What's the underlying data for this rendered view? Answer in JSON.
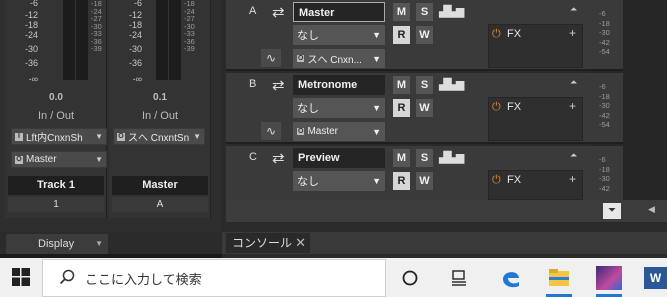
{
  "mixer": {
    "scale_labels": [
      "-6",
      "-12",
      "-18",
      "-24",
      "-30",
      "-36",
      "-∞"
    ],
    "mini_scale": [
      "-18",
      "-24",
      "-27",
      "-30",
      "-33",
      "-36",
      "-39"
    ],
    "strips": [
      {
        "level": "0.0",
        "io_label": "In / Out",
        "input_tag": "I",
        "input": "Lft内CnxnSh",
        "output_tag": "O",
        "output": "Master",
        "name": "Track 1",
        "number": "1"
      },
      {
        "level": "0.1",
        "io_label": "In / Out",
        "input_tag": "O",
        "input": "スへ CnxntSn",
        "name": "Master",
        "number": "A"
      }
    ],
    "display_label": "Display"
  },
  "tracks": [
    {
      "letter": "A",
      "name": "Master",
      "mute": "M",
      "solo": "S",
      "record": "R",
      "write": "W",
      "input": "なし",
      "output_tag": "O",
      "output": "スへ Cnxn...",
      "fx": "FX"
    },
    {
      "letter": "B",
      "name": "Metronome",
      "mute": "M",
      "solo": "S",
      "record": "R",
      "write": "W",
      "input": "なし",
      "output_tag": "O",
      "output": "Master",
      "fx": "FX"
    },
    {
      "letter": "C",
      "name": "Preview",
      "mute": "M",
      "solo": "S",
      "record": "R",
      "write": "W",
      "input": "なし",
      "fx": "FX"
    }
  ],
  "track_scale": [
    "-6",
    "-18",
    "-30",
    "-42",
    "-54"
  ],
  "console_tab": "コンソール",
  "taskbar": {
    "search_placeholder": "ここに入力して検索",
    "word_label": "W"
  },
  "icons": [
    "windows-icon",
    "search-icon",
    "cortana-icon",
    "task-view-icon",
    "edge-icon",
    "file-explorer-icon",
    "photo-app-icon",
    "word-icon"
  ],
  "colors": {
    "accent_orange": "#e88a2a",
    "taskbar": "#f0f0f0",
    "edge_blue": "#1e78d6"
  }
}
